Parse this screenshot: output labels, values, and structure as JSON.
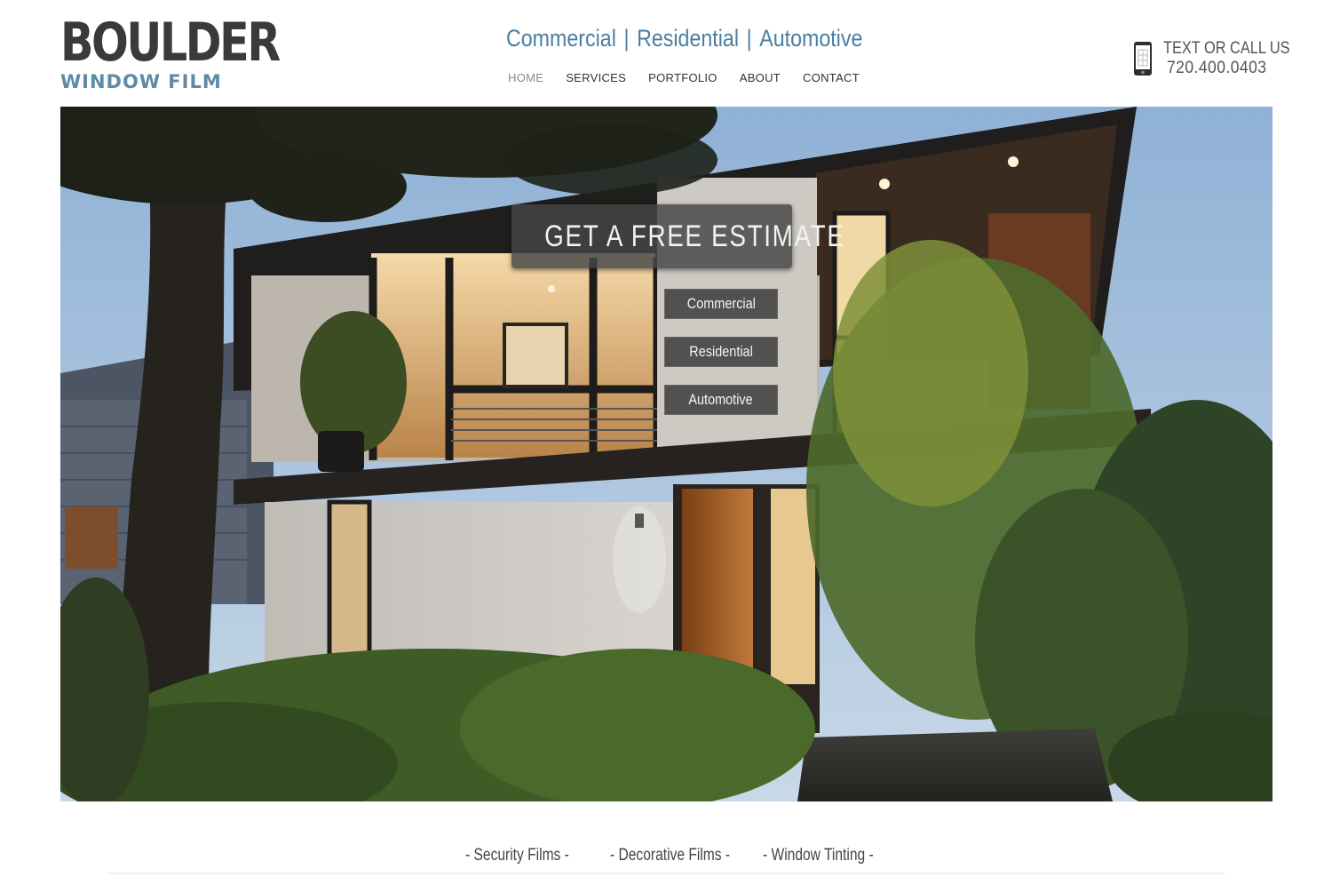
{
  "logo": {
    "line1": "BOULDER",
    "line2": "WINDOW FILM"
  },
  "tagline": {
    "item1": "Commercial",
    "item2": "Residential",
    "item3": "Automotive",
    "separator": "|"
  },
  "nav": {
    "items": [
      {
        "label": "HOME",
        "active": true
      },
      {
        "label": "SERVICES"
      },
      {
        "label": "PORTFOLIO"
      },
      {
        "label": "ABOUT"
      },
      {
        "label": "CONTACT"
      }
    ]
  },
  "contact": {
    "label": "TEXT OR CALL US",
    "number": "720.400.0403",
    "icon": "phone-icon"
  },
  "hero": {
    "cta": "GET A FREE ESTIMATE",
    "buttons": [
      {
        "label": "Commercial"
      },
      {
        "label": "Residential"
      },
      {
        "label": "Automotive"
      }
    ]
  },
  "bottom_links": [
    {
      "label": "-  Security Films  -"
    },
    {
      "label": "-  Decorative Films  -"
    },
    {
      "label": "-  Window Tinting -"
    }
  ],
  "colors": {
    "brand_blue": "#4a7ea5",
    "logo_dark": "#3a3a3a",
    "logo_blue": "#5e8aa6"
  }
}
